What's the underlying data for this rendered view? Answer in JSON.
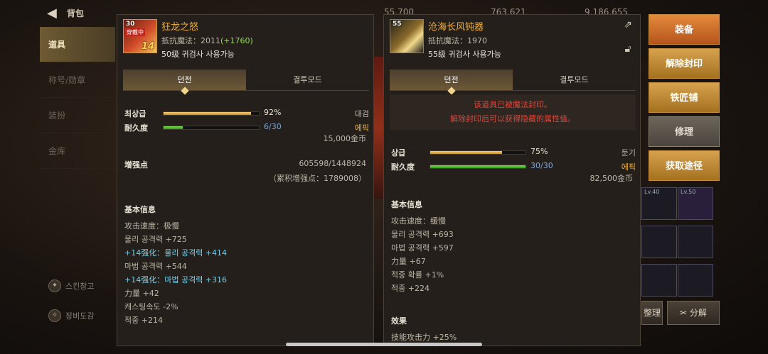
{
  "topbar": {
    "back_icon": "back-arrow-icon",
    "title": "背包",
    "currency1": "55,700",
    "currency2": "763,621",
    "currency3": "9,186,655"
  },
  "nav": {
    "items": [
      {
        "label": "道具",
        "active": true
      },
      {
        "label": "称号/勋章",
        "active": false
      },
      {
        "label": "装扮",
        "active": false
      },
      {
        "label": "金库",
        "active": false
      }
    ],
    "bottom": [
      {
        "label": "스킨창고"
      },
      {
        "label": "장비도감"
      }
    ]
  },
  "panel_a": {
    "name": "狂龙之怒",
    "icon": {
      "level": "30",
      "equip_tag": "穿戴中",
      "plus": "14"
    },
    "resist_label": "抵抗魔法：2011",
    "resist_bonus": "(+1760)",
    "requirement": "50级 귀검사 사용가능",
    "tabs": [
      "던전",
      "결투모드"
    ],
    "grade": {
      "label": "최상급",
      "value": "92%",
      "fill": 0.92,
      "right": "대검"
    },
    "durability": {
      "label": "耐久度",
      "value": "6/30",
      "fill": 0.2,
      "right": "에픽"
    },
    "price": "15,000金币",
    "enhance_label": "增强点",
    "enhance_value": "605598/1448924",
    "enhance_total": "（累积增强点：1789008）",
    "basic_title": "基本信息",
    "lines": [
      {
        "text": "攻击速度：极慢",
        "cyan": false
      },
      {
        "text": "물리 공격력 +725",
        "cyan": false
      },
      {
        "text": "+14强化：물리 공격력 +414",
        "cyan": true
      },
      {
        "text": "마법 공격력 +544",
        "cyan": false
      },
      {
        "text": "+14强化：마법 공격력 +316",
        "cyan": true
      },
      {
        "text": "力量 +42",
        "cyan": false
      },
      {
        "text": "캐스팅속도 -2%",
        "cyan": false
      },
      {
        "text": "적중 +214",
        "cyan": false
      }
    ]
  },
  "panel_b": {
    "name": "沧海长风钝器",
    "icon": {
      "level": "55"
    },
    "resist_label": "抵抗魔法：1970",
    "requirement": "55级 귀검사 사용가능",
    "tabs": [
      "던전",
      "결투모드"
    ],
    "seal_line1": "该道具已被魔法封印。",
    "seal_line2": "解除封印后可以获得隐藏的属性值。",
    "grade": {
      "label": "상급",
      "value": "75%",
      "fill": 0.75,
      "right": "둔기"
    },
    "durability": {
      "label": "耐久度",
      "value": "30/30",
      "fill": 1.0,
      "right": "에픽"
    },
    "price": "82,500金币",
    "basic_title": "基本信息",
    "lines": [
      "攻击速度：缓慢",
      "물리 공격력 +693",
      "마법 공격력 +597",
      "力量 +67",
      "적중 확률 +1%",
      "적중 +224"
    ],
    "effect_title": "效果",
    "effect_line": "技能攻击力 +25%"
  },
  "actions": {
    "equip": "装备",
    "unseal": "解除封印",
    "blacksmith": "铁匠铺",
    "repair": "修理",
    "obtain": "获取途径"
  },
  "inventory": {
    "slot1_level": "Lv.40",
    "slot2_level": "Lv.50",
    "disassemble": "分解",
    "sort": "整理"
  },
  "colors": {
    "accent_orange": "#d9772f",
    "gold": "#f0b03a",
    "sealed_red": "#e0453a",
    "enhance_cyan": "#6fd0f0"
  }
}
